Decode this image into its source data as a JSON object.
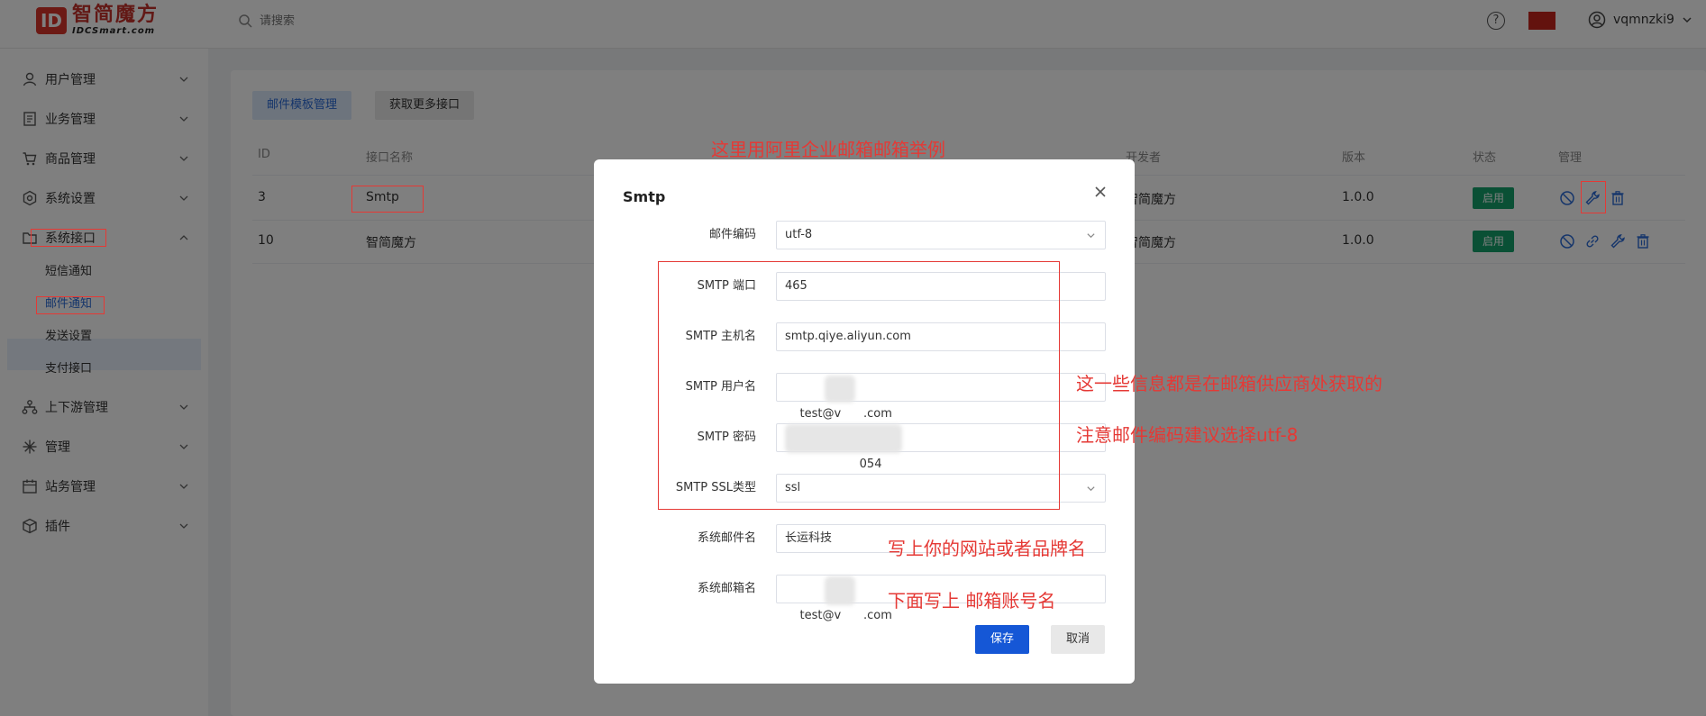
{
  "header": {
    "logo_text": "智简魔方",
    "logo_sub": "IDCSmart.com",
    "search_placeholder": "请搜索",
    "user_name": "vqmnzki9"
  },
  "sidebar": {
    "items": [
      {
        "label": "用户管理",
        "icon": "user-icon"
      },
      {
        "label": "业务管理",
        "icon": "document-icon"
      },
      {
        "label": "商品管理",
        "icon": "cart-icon"
      },
      {
        "label": "系统设置",
        "icon": "gear-icon"
      },
      {
        "label": "系统接口",
        "icon": "folder-icon"
      },
      {
        "label": "上下游管理",
        "icon": "hierarchy-icon"
      },
      {
        "label": "管理",
        "icon": "asterisk-icon"
      },
      {
        "label": "站务管理",
        "icon": "calendar-icon"
      },
      {
        "label": "插件",
        "icon": "cube-icon"
      }
    ],
    "sub_items": [
      "短信通知",
      "邮件通知",
      "发送设置",
      "支付接口"
    ]
  },
  "main": {
    "tabs": [
      "邮件模板管理",
      "获取更多接口"
    ],
    "columns": [
      "ID",
      "接口名称",
      "开发者",
      "版本",
      "状态",
      "管理"
    ],
    "rows": [
      {
        "id": "3",
        "name": "Smtp",
        "developer": "智简魔方",
        "version": "1.0.0",
        "status": "启用"
      },
      {
        "id": "10",
        "name": "智简魔方",
        "developer": "智简魔方",
        "version": "1.0.0",
        "status": "启用"
      }
    ]
  },
  "modal": {
    "title": "Smtp",
    "fields": [
      {
        "label": "邮件编码",
        "value": "utf-8",
        "type": "select"
      },
      {
        "label": "SMTP 端口",
        "value": "465",
        "type": "input"
      },
      {
        "label": "SMTP 主机名",
        "value": "smtp.qiye.aliyun.com",
        "type": "input"
      },
      {
        "label": "SMTP 用户名",
        "value": "test@v      .com",
        "type": "input"
      },
      {
        "label": "SMTP 密码",
        "value": "                054",
        "type": "input"
      },
      {
        "label": "SMTP SSL类型",
        "value": "ssl",
        "type": "select"
      },
      {
        "label": "系统邮件名",
        "value": "长运科技",
        "type": "input"
      },
      {
        "label": "系统邮箱名",
        "value": "test@v      .com",
        "type": "input"
      }
    ],
    "save_label": "保存",
    "cancel_label": "取消"
  },
  "annotations": {
    "top_note": "这里用阿里企业邮箱邮箱举例",
    "note_provider": "这一些信息都是在邮箱供应商处获取的",
    "note_encoding": "注意邮件编码建议选择utf-8",
    "note_brand": "写上你的网站或者品牌名",
    "note_account": "下面写上 邮箱账号名"
  },
  "colors": {
    "primary": "#1557d6",
    "badge": "#14a06a",
    "annotation": "#e53935",
    "logo": "#c5302a"
  }
}
